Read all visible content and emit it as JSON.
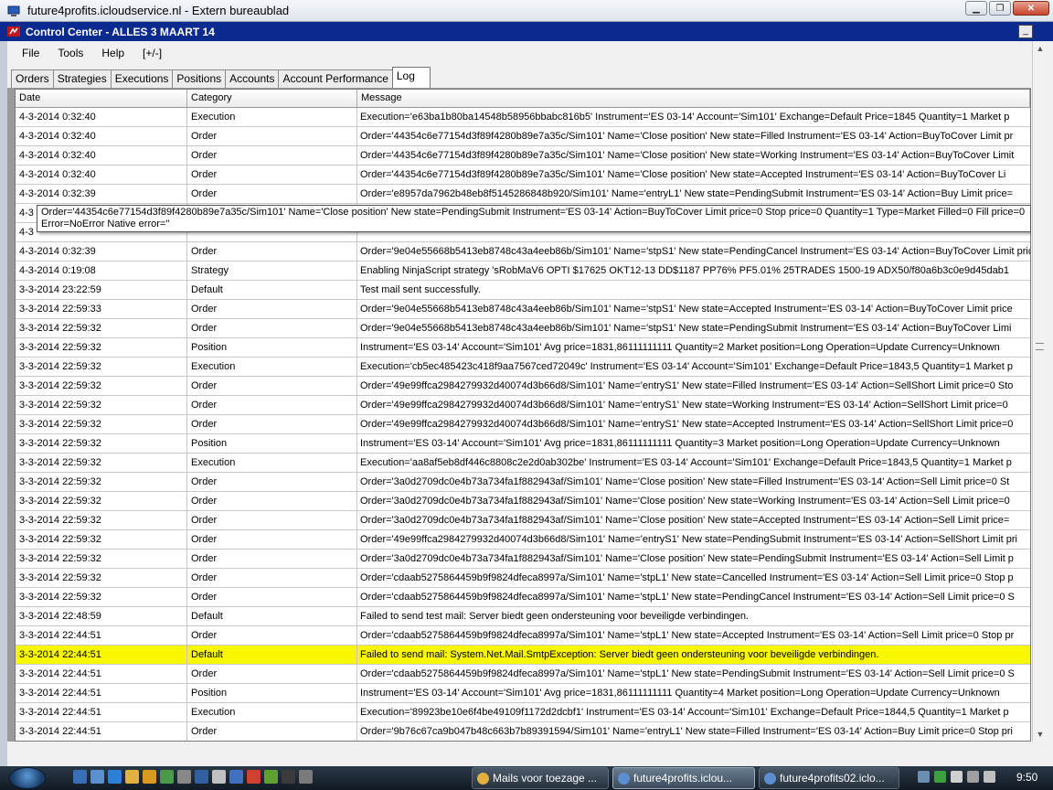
{
  "rdp": {
    "title": "future4profits.icloudservice.nl - Extern bureaublad"
  },
  "window": {
    "title": "Control Center - ALLES 3 MAART 14",
    "min_label": "_"
  },
  "menu": [
    "File",
    "Tools",
    "Help",
    "[+/-]"
  ],
  "tabs": [
    {
      "label": "Orders",
      "active": false
    },
    {
      "label": "Strategies",
      "active": false
    },
    {
      "label": "Executions",
      "active": false
    },
    {
      "label": "Positions",
      "active": false
    },
    {
      "label": "Accounts",
      "active": false
    },
    {
      "label": "Account Performance",
      "active": false
    },
    {
      "label": "Log",
      "active": true
    }
  ],
  "columns": {
    "date": "Date",
    "category": "Category",
    "message": "Message"
  },
  "rows": [
    {
      "date": "4-3-2014 0:32:40",
      "category": "Execution",
      "message": "Execution='e63ba1b80ba14548b58956bbabc816b5' Instrument='ES 03-14' Account='Sim101' Exchange=Default Price=1845 Quantity=1 Market p"
    },
    {
      "date": "4-3-2014 0:32:40",
      "category": "Order",
      "message": "Order='44354c6e77154d3f89f4280b89e7a35c/Sim101' Name='Close position' New state=Filled Instrument='ES 03-14' Action=BuyToCover Limit pr"
    },
    {
      "date": "4-3-2014 0:32:40",
      "category": "Order",
      "message": "Order='44354c6e77154d3f89f4280b89e7a35c/Sim101' Name='Close position' New state=Working Instrument='ES 03-14' Action=BuyToCover Limit"
    },
    {
      "date": "4-3-2014 0:32:40",
      "category": "Order",
      "message": "Order='44354c6e77154d3f89f4280b89e7a35c/Sim101' Name='Close position' New state=Accepted Instrument='ES 03-14' Action=BuyToCover Li"
    },
    {
      "date": "4-3-2014 0:32:39",
      "category": "Order",
      "message": "Order='e8957da7962b48eb8f5145286848b920/Sim101' Name='entryL1' New state=PendingSubmit Instrument='ES 03-14' Action=Buy Limit price="
    },
    {
      "date": "4-3",
      "category": "",
      "message": ""
    },
    {
      "date": "4-3",
      "category": "",
      "message": ""
    },
    {
      "date": "4-3-2014 0:32:39",
      "category": "Order",
      "message": "Order='9e04e55668b5413eb8748c43a4eeb86b/Sim101' Name='stpS1' New state=PendingCancel Instrument='ES 03-14' Action=BuyToCover Limit pric"
    },
    {
      "date": "4-3-2014 0:19:08",
      "category": "Strategy",
      "message": "Enabling NinjaScript strategy 'sRobMaV6 OPTI $17625 OKT12-13 DD$1187 PP76% PF5.01% 25TRADES 1500-19 ADX50/f80a6b3c0e9d45dab1"
    },
    {
      "date": "3-3-2014 23:22:59",
      "category": "Default",
      "message": "Test mail sent successfully."
    },
    {
      "date": "3-3-2014 22:59:33",
      "category": "Order",
      "message": "Order='9e04e55668b5413eb8748c43a4eeb86b/Sim101' Name='stpS1' New state=Accepted Instrument='ES 03-14' Action=BuyToCover Limit price"
    },
    {
      "date": "3-3-2014 22:59:32",
      "category": "Order",
      "message": "Order='9e04e55668b5413eb8748c43a4eeb86b/Sim101' Name='stpS1' New state=PendingSubmit Instrument='ES 03-14' Action=BuyToCover Limi"
    },
    {
      "date": "3-3-2014 22:59:32",
      "category": "Position",
      "message": "Instrument='ES 03-14' Account='Sim101' Avg price=1831,86111111111 Quantity=2 Market position=Long Operation=Update Currency=Unknown"
    },
    {
      "date": "3-3-2014 22:59:32",
      "category": "Execution",
      "message": "Execution='cb5ec485423c418f9aa7567ced72049c' Instrument='ES 03-14' Account='Sim101' Exchange=Default Price=1843,5 Quantity=1 Market p"
    },
    {
      "date": "3-3-2014 22:59:32",
      "category": "Order",
      "message": "Order='49e99ffca2984279932d40074d3b66d8/Sim101' Name='entryS1' New state=Filled Instrument='ES 03-14' Action=SellShort Limit price=0 Sto"
    },
    {
      "date": "3-3-2014 22:59:32",
      "category": "Order",
      "message": "Order='49e99ffca2984279932d40074d3b66d8/Sim101' Name='entryS1' New state=Working Instrument='ES 03-14' Action=SellShort Limit price=0"
    },
    {
      "date": "3-3-2014 22:59:32",
      "category": "Order",
      "message": "Order='49e99ffca2984279932d40074d3b66d8/Sim101' Name='entryS1' New state=Accepted Instrument='ES 03-14' Action=SellShort Limit price=0"
    },
    {
      "date": "3-3-2014 22:59:32",
      "category": "Position",
      "message": "Instrument='ES 03-14' Account='Sim101' Avg price=1831,86111111111 Quantity=3 Market position=Long Operation=Update Currency=Unknown"
    },
    {
      "date": "3-3-2014 22:59:32",
      "category": "Execution",
      "message": "Execution='aa8af5eb8df446c8808c2e2d0ab302be' Instrument='ES 03-14' Account='Sim101' Exchange=Default Price=1843,5 Quantity=1 Market p"
    },
    {
      "date": "3-3-2014 22:59:32",
      "category": "Order",
      "message": "Order='3a0d2709dc0e4b73a734fa1f882943af/Sim101' Name='Close position' New state=Filled Instrument='ES 03-14' Action=Sell Limit price=0 St"
    },
    {
      "date": "3-3-2014 22:59:32",
      "category": "Order",
      "message": "Order='3a0d2709dc0e4b73a734fa1f882943af/Sim101' Name='Close position' New state=Working Instrument='ES 03-14' Action=Sell Limit price=0"
    },
    {
      "date": "3-3-2014 22:59:32",
      "category": "Order",
      "message": "Order='3a0d2709dc0e4b73a734fa1f882943af/Sim101' Name='Close position' New state=Accepted Instrument='ES 03-14' Action=Sell Limit price="
    },
    {
      "date": "3-3-2014 22:59:32",
      "category": "Order",
      "message": "Order='49e99ffca2984279932d40074d3b66d8/Sim101' Name='entryS1' New state=PendingSubmit Instrument='ES 03-14' Action=SellShort Limit pri"
    },
    {
      "date": "3-3-2014 22:59:32",
      "category": "Order",
      "message": "Order='3a0d2709dc0e4b73a734fa1f882943af/Sim101' Name='Close position' New state=PendingSubmit Instrument='ES 03-14' Action=Sell Limit p"
    },
    {
      "date": "3-3-2014 22:59:32",
      "category": "Order",
      "message": "Order='cdaab5275864459b9f9824dfeca8997a/Sim101' Name='stpL1' New state=Cancelled Instrument='ES 03-14' Action=Sell Limit price=0 Stop p"
    },
    {
      "date": "3-3-2014 22:59:32",
      "category": "Order",
      "message": "Order='cdaab5275864459b9f9824dfeca8997a/Sim101' Name='stpL1' New state=PendingCancel Instrument='ES 03-14' Action=Sell Limit price=0 S"
    },
    {
      "date": "3-3-2014 22:48:59",
      "category": "Default",
      "message": "Failed to send test mail: Server biedt geen ondersteuning voor beveiligde verbindingen."
    },
    {
      "date": "3-3-2014 22:44:51",
      "category": "Order",
      "message": "Order='cdaab5275864459b9f9824dfeca8997a/Sim101' Name='stpL1' New state=Accepted Instrument='ES 03-14' Action=Sell Limit price=0 Stop pr"
    },
    {
      "date": "3-3-2014 22:44:51",
      "category": "Default",
      "message": "Failed to send mail: System.Net.Mail.SmtpException: Server biedt geen ondersteuning voor beveiligde verbindingen.",
      "highlight": true
    },
    {
      "date": "3-3-2014 22:44:51",
      "category": "Order",
      "message": "Order='cdaab5275864459b9f9824dfeca8997a/Sim101' Name='stpL1' New state=PendingSubmit Instrument='ES 03-14' Action=Sell Limit price=0 S"
    },
    {
      "date": "3-3-2014 22:44:51",
      "category": "Position",
      "message": "Instrument='ES 03-14' Account='Sim101' Avg price=1831,86111111111 Quantity=4 Market position=Long Operation=Update Currency=Unknown"
    },
    {
      "date": "3-3-2014 22:44:51",
      "category": "Execution",
      "message": "Execution='89923be10e6f4be49109f1172d2dcbf1' Instrument='ES 03-14' Account='Sim101' Exchange=Default Price=1844,5 Quantity=1 Market p"
    },
    {
      "date": "3-3-2014 22:44:51",
      "category": "Order",
      "message": "Order='9b76c67ca9b047b48c663b7b89391594/Sim101' Name='entryL1' New state=Filled Instrument='ES 03-14' Action=Buy Limit price=0 Stop pri"
    }
  ],
  "tooltip": "Order='44354c6e77154d3f89f4280b89e7a35c/Sim101' Name='Close position' New state=PendingSubmit Instrument='ES 03-14' Action=BuyToCover Limit price=0 Stop price=0 Quantity=1 Type=Market Filled=0 Fill price=0 Error=NoError Native error=''",
  "taskbar": {
    "buttons": [
      "Mails voor toezage ...",
      "future4profits.iclou...",
      "future4profits02.iclo..."
    ],
    "clock": "9:50"
  },
  "colors": {
    "highlight": "#f7f700",
    "title_bar": "#0b2a8f"
  }
}
